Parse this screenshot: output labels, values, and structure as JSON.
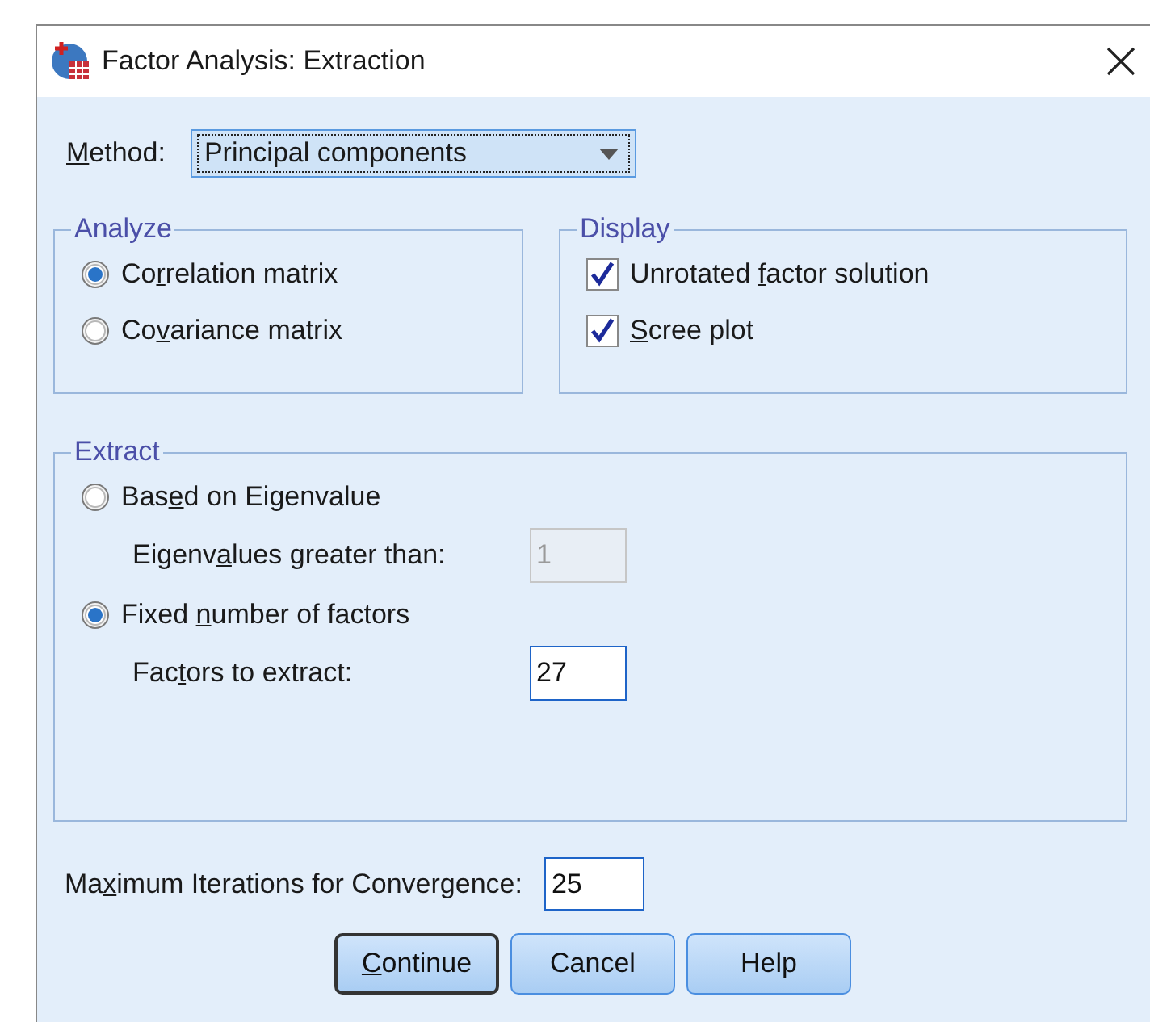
{
  "window": {
    "title": "Factor Analysis: Extraction"
  },
  "method": {
    "label": {
      "key": "M",
      "after": "ethod:"
    },
    "value": "Principal components"
  },
  "analyze": {
    "title": "Analyze",
    "options": [
      {
        "label": {
          "before": "Co",
          "key": "r",
          "after": "relation matrix"
        },
        "selected": true
      },
      {
        "label": {
          "before": "Co",
          "key": "v",
          "after": "ariance matrix"
        },
        "selected": false
      }
    ]
  },
  "display": {
    "title": "Display",
    "options": [
      {
        "label": {
          "before": "Unrotated ",
          "key": "f",
          "after": "actor solution"
        },
        "checked": true
      },
      {
        "label": {
          "key": "S",
          "after": "cree plot"
        },
        "checked": true
      }
    ]
  },
  "extract": {
    "title": "Extract",
    "options": [
      {
        "label": {
          "before": "Bas",
          "key": "e",
          "after": "d on Eigenvalue"
        },
        "selected": false,
        "field": {
          "label": {
            "before": "Eigenv",
            "key": "a",
            "after": "lues greater than:"
          },
          "value": "1",
          "disabled": true
        }
      },
      {
        "label": {
          "before": "Fixed ",
          "key": "n",
          "after": "umber of factors"
        },
        "selected": true,
        "field": {
          "label": {
            "before": "Fac",
            "key": "t",
            "after": "ors to extract:"
          },
          "value": "27",
          "disabled": false
        }
      }
    ]
  },
  "iterations": {
    "label": {
      "before": "Ma",
      "key": "x",
      "after": "imum Iterations for Convergence:"
    },
    "value": "25"
  },
  "buttons": [
    {
      "label": {
        "key": "C",
        "after": "ontinue"
      },
      "default": true
    },
    {
      "label": {
        "after": "Cancel"
      },
      "default": false
    },
    {
      "label": {
        "after": "Help"
      },
      "default": false
    }
  ]
}
